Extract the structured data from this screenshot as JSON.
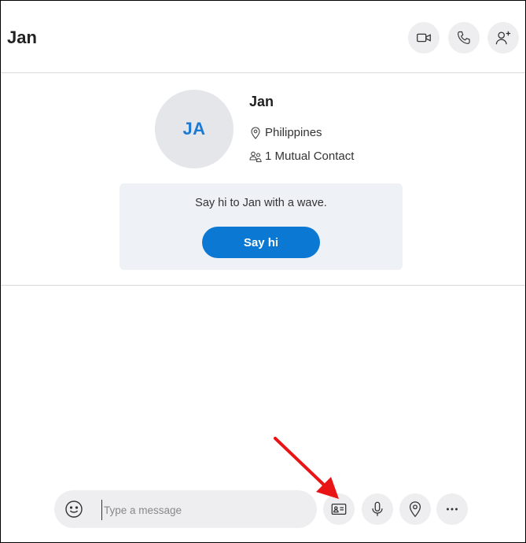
{
  "header": {
    "title": "Jan",
    "buttons": [
      {
        "name": "video-call",
        "icon": "video-camera-icon"
      },
      {
        "name": "audio-call",
        "icon": "phone-icon"
      },
      {
        "name": "add-people",
        "icon": "add-person-icon"
      }
    ]
  },
  "profile": {
    "initials": "JA",
    "name": "Jan",
    "location": "Philippines",
    "location_icon": "map-pin-icon",
    "mutual_contacts": "1 Mutual Contact",
    "mutual_icon": "people-icon"
  },
  "wave_card": {
    "text": "Say hi to Jan with a wave.",
    "button_label": "Say hi"
  },
  "composer": {
    "placeholder": "Type a message",
    "value": "",
    "emoji_icon": "smiley-icon",
    "actions": [
      {
        "name": "send-contact",
        "icon": "contact-card-icon"
      },
      {
        "name": "voice-message",
        "icon": "microphone-icon"
      },
      {
        "name": "send-location",
        "icon": "location-pin-icon"
      },
      {
        "name": "more-options",
        "icon": "ellipsis-icon"
      }
    ]
  },
  "annotation": {
    "type": "red-arrow",
    "points_to": "send-contact"
  },
  "colors": {
    "accent": "#0b78d3",
    "avatar_bg": "#e5e6ea",
    "card_bg": "#eef1f6",
    "button_bg": "#eeeef0",
    "divider": "#d9d9d9",
    "arrow": "#e81416"
  }
}
